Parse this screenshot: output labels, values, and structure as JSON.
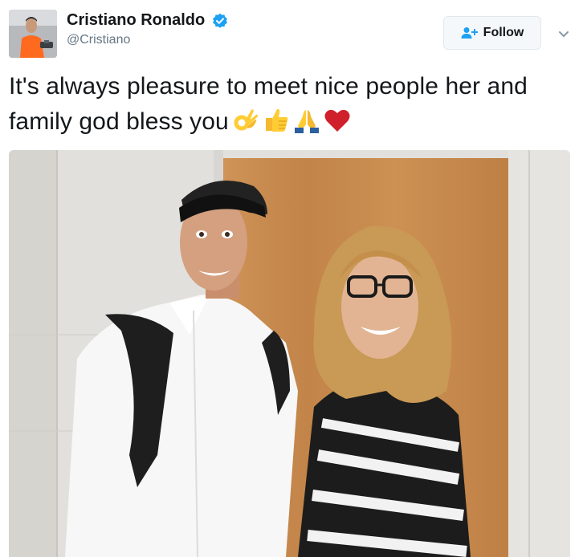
{
  "user": {
    "display_name": "Cristiano Ronaldo",
    "handle": "@Cristiano",
    "avatar_icon": "profile-photo",
    "verified_icon": "verified-badge-icon",
    "verified_color": "#1da1f2"
  },
  "follow_button": {
    "label": "Follow",
    "icon": "add-user-icon",
    "accent": "#1da1f2"
  },
  "menu": {
    "icon": "chevron-down-icon"
  },
  "tweet": {
    "text": "It's always pleasure to meet nice people her and family god bless you",
    "emojis": [
      "ok-hand-emoji",
      "thumbs-up-emoji",
      "folded-hands-emoji",
      "red-heart-emoji"
    ]
  },
  "media": {
    "type": "photo",
    "description_icon": "tweet-photo"
  }
}
